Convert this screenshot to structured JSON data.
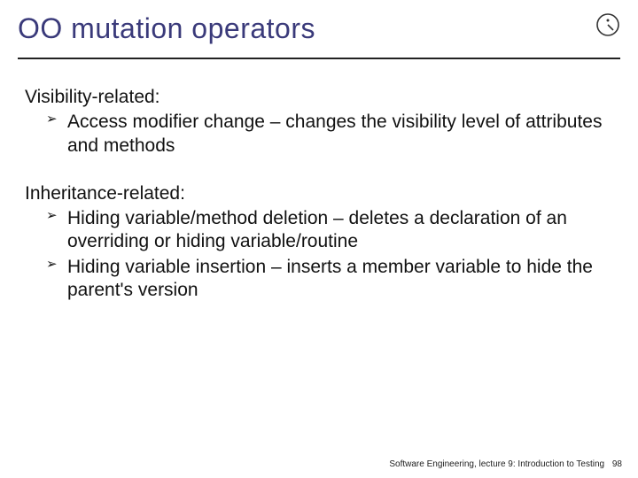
{
  "title": "OO mutation operators",
  "sections": [
    {
      "heading": "Visibility-related:",
      "items": [
        "Access modifier change – changes the visibility level of attributes and methods"
      ]
    },
    {
      "heading": "Inheritance-related:",
      "items": [
        "Hiding variable/method deletion – deletes a declaration of an overriding or hiding variable/routine",
        "Hiding variable insertion – inserts a member variable to hide the parent's version"
      ]
    }
  ],
  "footer": {
    "text": "Software Engineering, lecture 9: Introduction to Testing",
    "page": "98"
  }
}
